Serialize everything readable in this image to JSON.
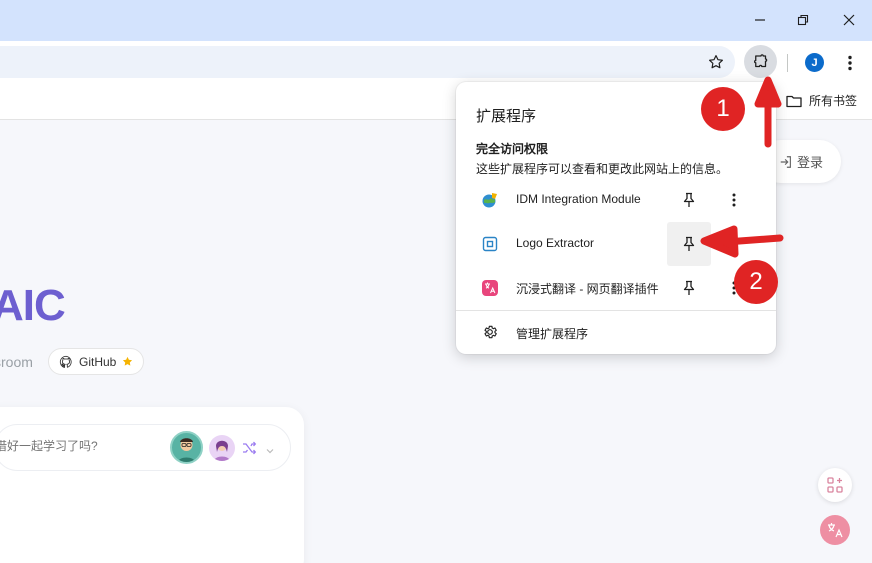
{
  "toolbar": {
    "avatar_initial": "J"
  },
  "bookmarks": {
    "all_label": "所有书签"
  },
  "page": {
    "login_label": "登录",
    "hero_text": "AIC",
    "subline": "sroom",
    "github_label": "GitHub",
    "input_placeholder": "借好一起学习了吗?"
  },
  "extensions_popup": {
    "title": "扩展程序",
    "section_title": "完全访问权限",
    "section_desc": "这些扩展程序可以查看和更改此网站上的信息。",
    "items": [
      {
        "name": "IDM Integration Module",
        "icon": "idm-icon"
      },
      {
        "name": "Logo Extractor",
        "icon": "logo-extractor-icon"
      },
      {
        "name": "沉浸式翻译 - 网页翻译插件",
        "icon": "immersive-translate-icon"
      }
    ],
    "manage_label": "管理扩展程序"
  },
  "annotations": {
    "marker_1": "1",
    "marker_2": "2"
  },
  "colors": {
    "accent": "#6d5fd0",
    "marker": "#e02424",
    "titlebar": "#d3e3fd"
  }
}
